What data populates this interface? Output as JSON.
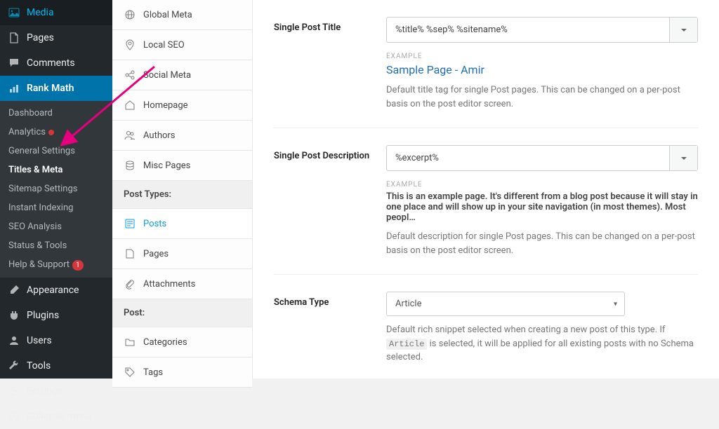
{
  "sidebar": {
    "items": [
      {
        "label": "Media",
        "icon": "media"
      },
      {
        "label": "Pages",
        "icon": "page"
      },
      {
        "label": "Comments",
        "icon": "comment"
      },
      {
        "label": "Rank Math",
        "icon": "chart",
        "active": true
      }
    ],
    "sub": [
      {
        "label": "Dashboard"
      },
      {
        "label": "Analytics",
        "dot": true
      },
      {
        "label": "General Settings"
      },
      {
        "label": "Titles & Meta",
        "active": true
      },
      {
        "label": "Sitemap Settings"
      },
      {
        "label": "Instant Indexing"
      },
      {
        "label": "SEO Analysis"
      },
      {
        "label": "Status & Tools"
      },
      {
        "label": "Help & Support",
        "badge": "1"
      }
    ],
    "items2": [
      {
        "label": "Appearance",
        "icon": "brush"
      },
      {
        "label": "Plugins",
        "icon": "plugin"
      },
      {
        "label": "Users",
        "icon": "user"
      },
      {
        "label": "Tools",
        "icon": "wrench"
      },
      {
        "label": "Settings",
        "icon": "settings"
      }
    ],
    "collapse": "Collapse menu"
  },
  "tabs": {
    "items": [
      {
        "label": "Global Meta",
        "icon": "globe"
      },
      {
        "label": "Local SEO",
        "icon": "pin"
      },
      {
        "label": "Social Meta",
        "icon": "share"
      },
      {
        "label": "Homepage",
        "icon": "home"
      },
      {
        "label": "Authors",
        "icon": "users"
      },
      {
        "label": "Misc Pages",
        "icon": "stack"
      }
    ],
    "section_post_types": "Post Types:",
    "post_types": [
      {
        "label": "Posts",
        "icon": "post",
        "active": true
      },
      {
        "label": "Pages",
        "icon": "page"
      },
      {
        "label": "Attachments",
        "icon": "clip"
      }
    ],
    "section_post": "Post:",
    "post_tax": [
      {
        "label": "Categories",
        "icon": "folder"
      },
      {
        "label": "Tags",
        "icon": "tag"
      }
    ]
  },
  "settings": {
    "title": {
      "label": "Single Post Title",
      "value": "%title% %sep% %sitename%",
      "example_label": "EXAMPLE",
      "example_text": "Sample Page - Amir",
      "help": "Default title tag for single Post pages. This can be changed on a per-post basis on the post editor screen."
    },
    "desc": {
      "label": "Single Post Description",
      "value": "%excerpt%",
      "example_label": "EXAMPLE",
      "example_text": "This is an example page. It's different from a blog post because it will stay in one place and will show up in your site navigation (in most themes). Most peopl…",
      "help": "Default description for single Post pages. This can be changed on a per-post basis on the post editor screen."
    },
    "schema": {
      "label": "Schema Type",
      "value": "Article",
      "help_pre": "Default rich snippet selected when creating a new post of this type. If ",
      "help_code": "Article",
      "help_post": " is selected, it will be applied for all existing posts with no Schema selected."
    }
  }
}
